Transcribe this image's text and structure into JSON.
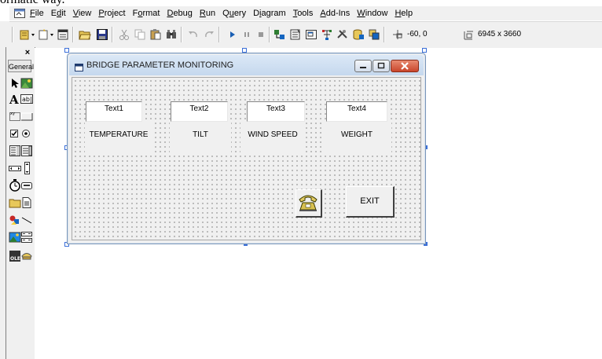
{
  "caption_fragment": "ormatic way.",
  "menu": {
    "items": [
      {
        "key": "F",
        "rest": "ile"
      },
      {
        "key": "",
        "pre": "E",
        "rest": "dit",
        "under": "E"
      },
      {
        "key": "V",
        "rest": "iew"
      },
      {
        "key": "P",
        "rest": "roject"
      },
      {
        "key": "",
        "pre": "F",
        "rest": "ormat"
      },
      {
        "key": "D",
        "rest": "ebug"
      },
      {
        "key": "R",
        "rest": "un"
      },
      {
        "key": "",
        "pre": "Q",
        "rest": "uery"
      },
      {
        "key": "",
        "pre": "D",
        "rest": "iagram"
      },
      {
        "key": "T",
        "rest": "ools"
      },
      {
        "key": "A",
        "rest": "dd-Ins"
      },
      {
        "key": "W",
        "rest": "indow"
      },
      {
        "key": "H",
        "rest": "elp"
      }
    ],
    "labels": [
      "File",
      "Edit",
      "View",
      "Project",
      "Format",
      "Debug",
      "Run",
      "Query",
      "Diagram",
      "Tools",
      "Add-Ins",
      "Window",
      "Help"
    ],
    "underline_index": [
      0,
      1,
      0,
      0,
      1,
      0,
      0,
      1,
      1,
      0,
      0,
      0,
      0
    ]
  },
  "toolbar": {
    "position": "-60, 0",
    "size": "6945 x 3660"
  },
  "toolbox": {
    "close": "×",
    "tab": "General"
  },
  "form": {
    "title": "BRIDGE PARAMETER MONITORING",
    "textboxes": [
      "Text1",
      "Text2",
      "Text3",
      "Text4"
    ],
    "labels": [
      "TEMPERATURE",
      "TILT",
      "WIND SPEED",
      "WEIGHT"
    ],
    "exit_button": "EXIT"
  },
  "colors": {
    "title_gradient_top": "#dbe8f6",
    "close_button": "#c9462c",
    "selection_handle": "#3b6fd8"
  }
}
